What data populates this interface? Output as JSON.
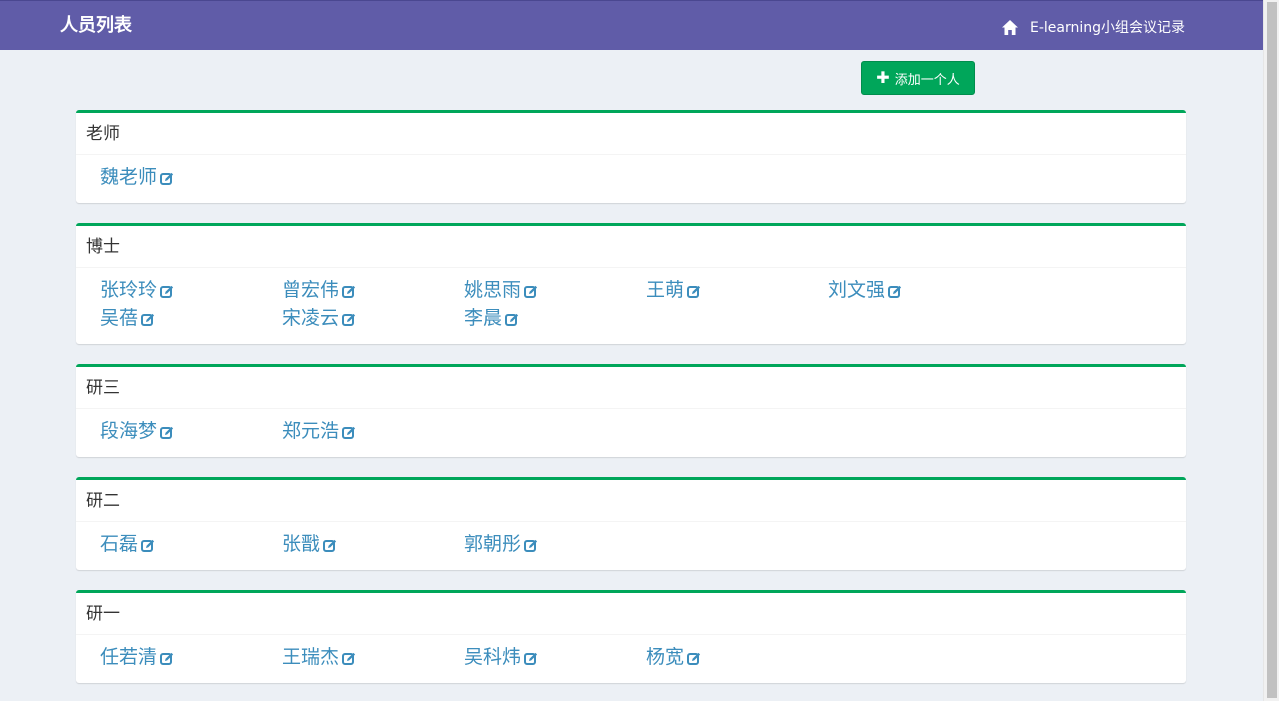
{
  "navbar": {
    "title": "人员列表",
    "home_label": "E-learning小组会议记录"
  },
  "toolbar": {
    "add_label": "添加一个人"
  },
  "colors": {
    "navbar_bg": "#605ca8",
    "accent_green": "#00a65a",
    "link_blue": "#3c8dbc",
    "page_bg": "#ecf0f5"
  },
  "groups": [
    {
      "title": "老师",
      "members": [
        "魏老师"
      ]
    },
    {
      "title": "博士",
      "members": [
        "张玲玲",
        "曾宏伟",
        "姚思雨",
        "王萌",
        "刘文强",
        "吴蓓",
        "宋凌云",
        "李晨"
      ]
    },
    {
      "title": "研三",
      "members": [
        "段海梦",
        "郑元浩"
      ]
    },
    {
      "title": "研二",
      "members": [
        "石磊",
        "张戬",
        "郭朝彤"
      ]
    },
    {
      "title": "研一",
      "members": [
        "任若清",
        "王瑞杰",
        "吴科炜",
        "杨宽"
      ]
    }
  ],
  "icons": {
    "home": "home-icon",
    "plus": "plus-icon",
    "edit": "edit-icon"
  }
}
